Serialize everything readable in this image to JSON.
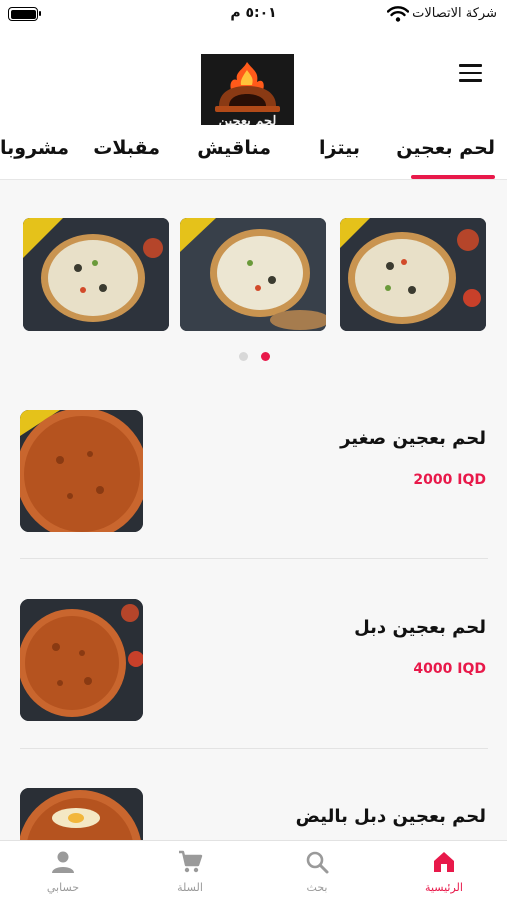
{
  "status_bar": {
    "carrier": "شركة الاتصالات",
    "time": "٥:٠١ م"
  },
  "header": {
    "logo_text": "لحم بعجين"
  },
  "categories": [
    {
      "label": "لحم بعجين",
      "active": true
    },
    {
      "label": "بيتزا",
      "active": false
    },
    {
      "label": "مناقيش",
      "active": false
    },
    {
      "label": "مقبلات",
      "active": false
    },
    {
      "label": "مشروبا",
      "active": false
    }
  ],
  "carousel": {
    "slide_count": 3,
    "dots": [
      {
        "active": true
      },
      {
        "active": false
      }
    ]
  },
  "products": [
    {
      "name": "لحم بعجين صغير",
      "price": "2000 IQD"
    },
    {
      "name": "لحم بعجين دبل",
      "price": "4000 IQD"
    },
    {
      "name": "لحم بعجين دبل باليض",
      "price": ""
    }
  ],
  "bottom_nav": [
    {
      "label": "الرئيسية",
      "icon": "home-icon",
      "active": true
    },
    {
      "label": "بحث",
      "icon": "search-icon",
      "active": false
    },
    {
      "label": "السلة",
      "icon": "cart-icon",
      "active": false
    },
    {
      "label": "حسابي",
      "icon": "person-icon",
      "active": false
    }
  ],
  "colors": {
    "accent": "#e8194a",
    "inactive": "#9a9a9a",
    "text": "#111111"
  }
}
